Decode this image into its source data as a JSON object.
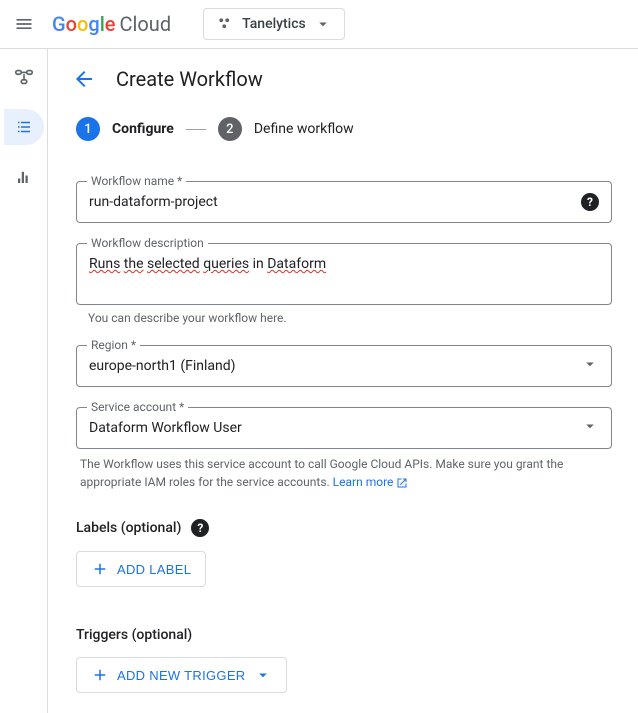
{
  "header": {
    "logo_cloud": "Cloud",
    "project": "Tanelytics"
  },
  "page": {
    "title": "Create Workflow"
  },
  "stepper": {
    "step1": {
      "num": "1",
      "label": "Configure"
    },
    "step2": {
      "num": "2",
      "label": "Define workflow"
    }
  },
  "fields": {
    "name": {
      "label": "Workflow name *",
      "value": "run-dataform-project"
    },
    "description": {
      "label": "Workflow description",
      "value_parts": {
        "p1": "Runs",
        "p2": "the",
        "p3": "selected",
        "p4": "queries",
        "p5": "in",
        "p6": "Dataform"
      },
      "hint": "You can describe your workflow here."
    },
    "region": {
      "label": "Region *",
      "value": "europe-north1 (Finland)"
    },
    "service_account": {
      "label": "Service account *",
      "value": "Dataform Workflow User",
      "desc": "The Workflow uses this service account to call Google Cloud APIs. Make sure you grant the appropriate IAM roles for the service accounts.",
      "learn_more": "Learn more"
    }
  },
  "sections": {
    "labels": {
      "title": "Labels (optional)",
      "button": "Add Label"
    },
    "triggers": {
      "title": "Triggers (optional)",
      "button": "Add New Trigger"
    }
  }
}
